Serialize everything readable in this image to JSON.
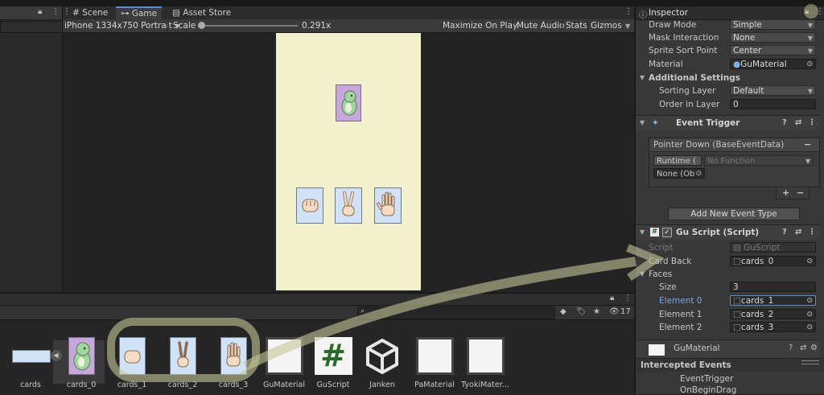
{
  "game_view": {
    "tabs": [
      {
        "label": "Scene",
        "icon": "scene-icon"
      },
      {
        "label": "Game",
        "icon": "game-controller-icon"
      },
      {
        "label": "Asset Store",
        "icon": "store-icon"
      }
    ],
    "toolbar": {
      "resolution": "iPhone 1334x750 Portrait",
      "scale_label": "Scale",
      "scale_value": "0.291x",
      "maximize_label": "Maximize On Play",
      "mute_label": "Mute Audio",
      "stats_label": "Stats",
      "gizmos_label": "Gizmos"
    },
    "scale_fraction": 0.0
  },
  "inspector": {
    "tab_label": "Inspector",
    "sprite_renderer": {
      "draw_mode": {
        "label": "Draw Mode",
        "value": "Simple"
      },
      "mask_interaction": {
        "label": "Mask Interaction",
        "value": "None"
      },
      "sprite_sort_point": {
        "label": "Sprite Sort Point",
        "value": "Center"
      },
      "material": {
        "label": "Material",
        "value": "GuMaterial"
      },
      "additional_settings": "Additional Settings",
      "sorting_layer": {
        "label": "Sorting Layer",
        "value": "Default"
      },
      "order_in_layer": {
        "label": "Order in Layer",
        "value": "0"
      }
    },
    "event_trigger": {
      "title": "Event Trigger",
      "event_name": "Pointer Down (BaseEventData)",
      "runtime": "Runtime (",
      "function": "No Function",
      "object": "None (Ob",
      "add_button": "Add New Event Type"
    },
    "gu_script": {
      "title": "Gu Script (Script)",
      "script": {
        "label": "Script",
        "value": "GuScript"
      },
      "card_back": {
        "label": "Card Back",
        "value": "cards_0"
      },
      "faces_label": "Faces",
      "size": {
        "label": "Size",
        "value": "3"
      },
      "elements": [
        {
          "label": "Element 0",
          "value": "cards_1"
        },
        {
          "label": "Element 1",
          "value": "cards_2"
        },
        {
          "label": "Element 2",
          "value": "cards_3"
        }
      ]
    },
    "material_name": "GuMaterial",
    "intercepted_events": "Intercepted Events",
    "events_list": [
      "EventTrigger",
      "OnBeginDrag"
    ]
  },
  "project": {
    "hidden_count": "17",
    "assets": [
      {
        "label": "cards",
        "kind": "sprite-sheet"
      },
      {
        "label": "cards_0",
        "kind": "card-back"
      },
      {
        "label": "cards_1",
        "kind": "rock-card"
      },
      {
        "label": "cards_2",
        "kind": "scissors-card"
      },
      {
        "label": "cards_3",
        "kind": "paper-card"
      },
      {
        "label": "GuMaterial",
        "kind": "material"
      },
      {
        "label": "GuScript",
        "kind": "script"
      },
      {
        "label": "Janken",
        "kind": "unity-scene"
      },
      {
        "label": "PaMaterial",
        "kind": "material"
      },
      {
        "label": "TyokiMater...",
        "kind": "material"
      }
    ]
  },
  "colors": {
    "game_background": "#f3f1cd",
    "card_face": "#cfe2f7",
    "card_back": "#c8a8dc",
    "annotation": "#c5c696",
    "selection": "#5a8ae0"
  }
}
